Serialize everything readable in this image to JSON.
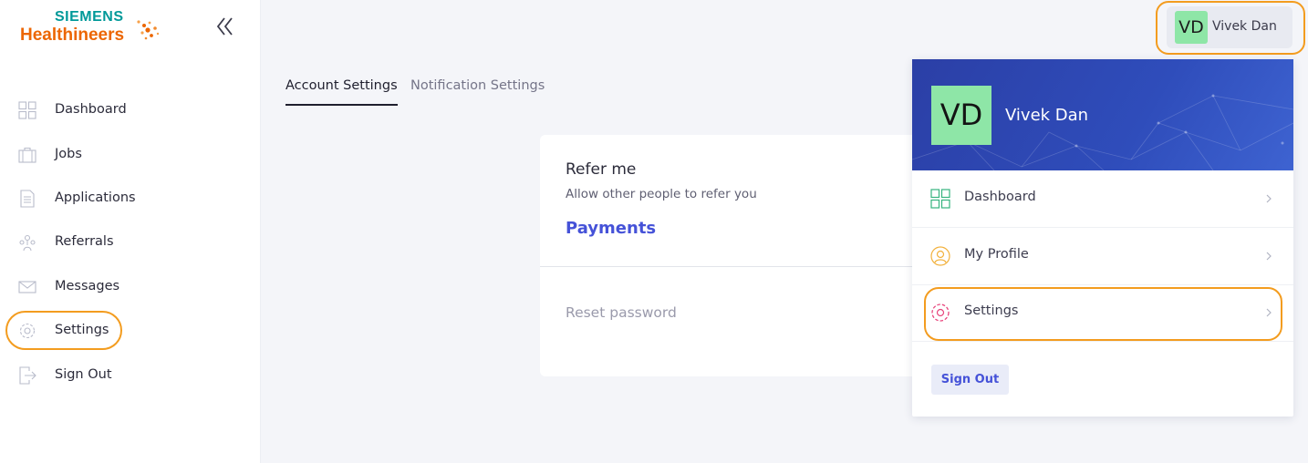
{
  "brand": {
    "line1": "SIEMENS",
    "line2": "Healthineers",
    "primary_color": "#009999",
    "accent_color": "#ec6602"
  },
  "sidebar": {
    "collapse_icon": "double-chevron-left-icon",
    "items": [
      {
        "label": "Dashboard",
        "icon": "grid-icon"
      },
      {
        "label": "Jobs",
        "icon": "briefcase-icon"
      },
      {
        "label": "Applications",
        "icon": "document-icon"
      },
      {
        "label": "Referrals",
        "icon": "people-network-icon"
      },
      {
        "label": "Messages",
        "icon": "envelope-icon"
      },
      {
        "label": "Settings",
        "icon": "gear-icon",
        "highlighted": true
      },
      {
        "label": "Sign Out",
        "icon": "sign-out-icon"
      }
    ]
  },
  "tabs": [
    {
      "label": "Account Settings",
      "active": true
    },
    {
      "label": "Notification Settings",
      "active": false
    }
  ],
  "card": {
    "title": "Refer me",
    "description": "Allow other people to refer you",
    "payments_label": "Payments",
    "reset_label": "Reset password"
  },
  "user": {
    "initials": "VD",
    "name": "Vivek Dan",
    "avatar_color": "#8ee6a7"
  },
  "dropdown": {
    "header_color": "#2f4dbb",
    "items": [
      {
        "label": "Dashboard",
        "icon": "grid-icon"
      },
      {
        "label": "My Profile",
        "icon": "profile-icon"
      },
      {
        "label": "Settings",
        "icon": "gear-icon",
        "highlighted": true
      }
    ],
    "signout_label": "Sign Out",
    "highlight_color": "#f39c1f"
  }
}
